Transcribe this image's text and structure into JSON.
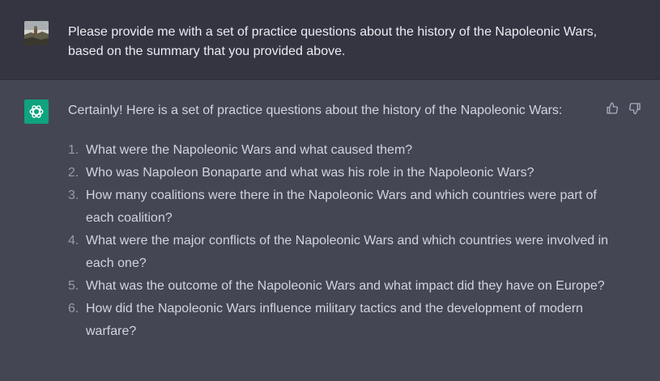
{
  "user_message": {
    "text": "Please provide me with a set of practice questions about the history of the Napoleonic Wars, based on the summary that you provided above."
  },
  "assistant_message": {
    "intro": "Certainly! Here is a set of practice questions about the history of the Napoleonic Wars:",
    "questions": [
      {
        "num": "1.",
        "text": "What were the Napoleonic Wars and what caused them?"
      },
      {
        "num": "2.",
        "text": "Who was Napoleon Bonaparte and what was his role in the Napoleonic Wars?"
      },
      {
        "num": "3.",
        "text": "How many coalitions were there in the Napoleonic Wars and which countries were part of each coalition?"
      },
      {
        "num": "4.",
        "text": "What were the major conflicts of the Napoleonic Wars and which countries were involved in each one?"
      },
      {
        "num": "5.",
        "text": "What was the outcome of the Napoleonic Wars and what impact did they have on Europe?"
      },
      {
        "num": "6.",
        "text": "How did the Napoleonic Wars influence military tactics and the development of modern warfare?"
      }
    ]
  },
  "icons": {
    "user_avatar": "landscape-photo-avatar",
    "assistant_avatar": "openai-logo-icon",
    "thumbs_up": "thumbs-up-icon",
    "thumbs_down": "thumbs-down-icon"
  },
  "colors": {
    "user_bg": "#343541",
    "assistant_bg": "#444654",
    "assistant_avatar_bg": "#10a37f"
  }
}
